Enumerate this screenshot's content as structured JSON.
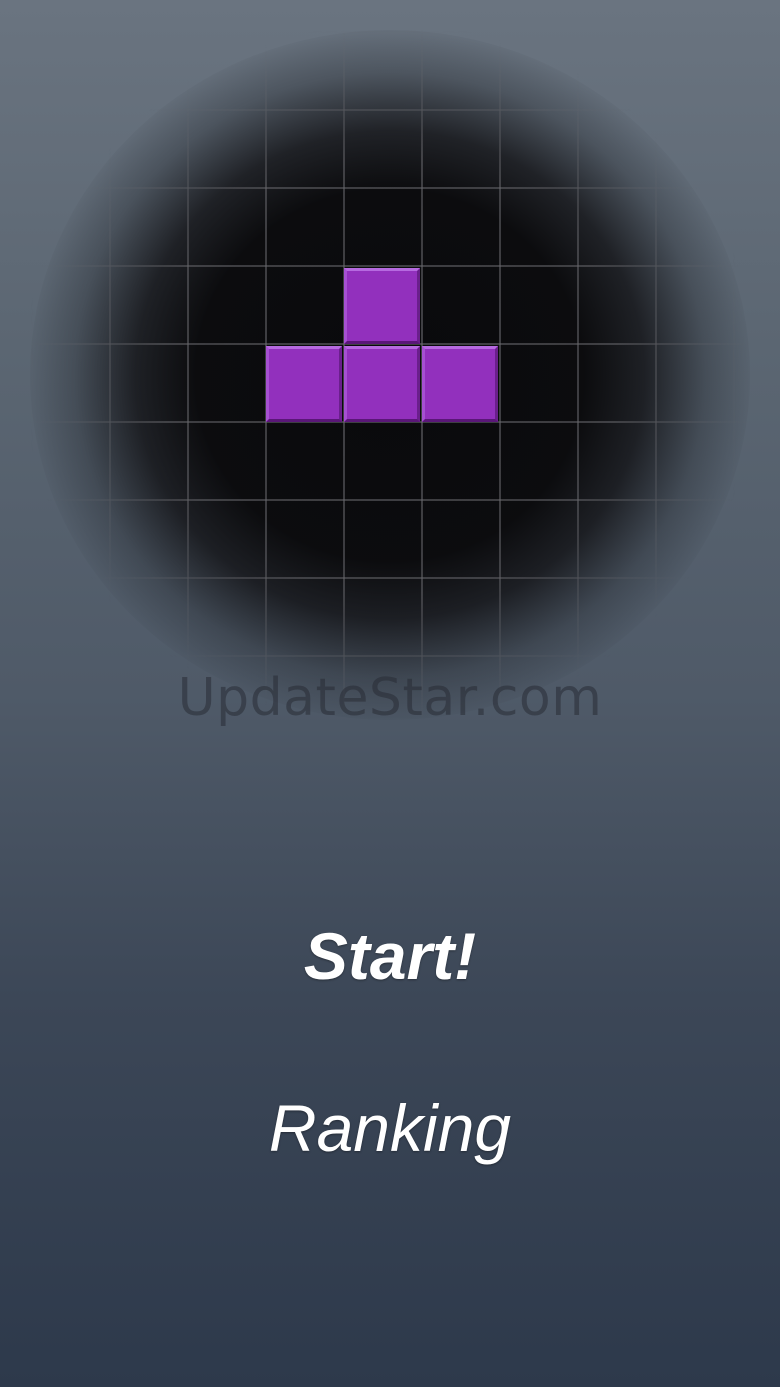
{
  "board": {
    "piece_type": "T",
    "piece_color": "#9230bd"
  },
  "watermark": "UpdateStar.com",
  "menu": {
    "start_label": "Start!",
    "ranking_label": "Ranking"
  }
}
